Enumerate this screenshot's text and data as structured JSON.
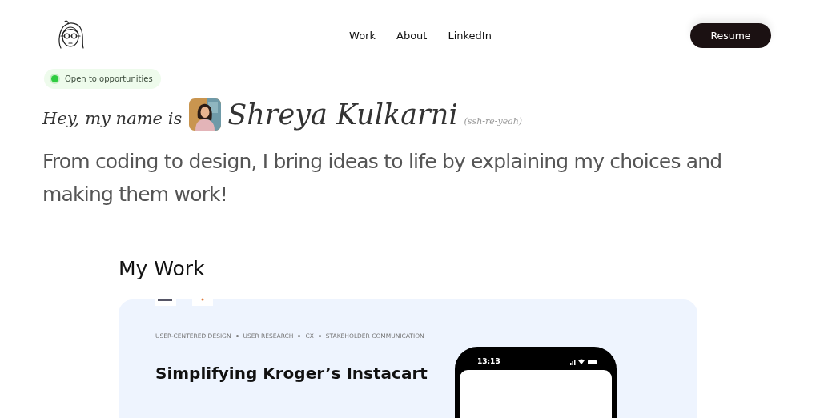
{
  "nav": {
    "links": [
      "Work",
      "About",
      "LinkedIn"
    ],
    "resume_button": "Resume"
  },
  "status_badge": {
    "label": "Open to opportunities",
    "color": "#2ecc40"
  },
  "intro": {
    "greeting": "Hey, my name is",
    "name": "Shreya Kulkarni",
    "pronunciation": "(ssh-re-yeah)"
  },
  "tagline": "From coding to design, I bring ideas to life by explaining my choices and making them work!",
  "section_title": "My Work",
  "project_card": {
    "tags": [
      "USER-CENTERED DESIGN",
      "USER RESEARCH",
      "CX",
      "STAKEHOLDER COMMUNICATION"
    ],
    "title": "Simplifying Kroger’s Instacart",
    "phone_time": "13:13"
  }
}
